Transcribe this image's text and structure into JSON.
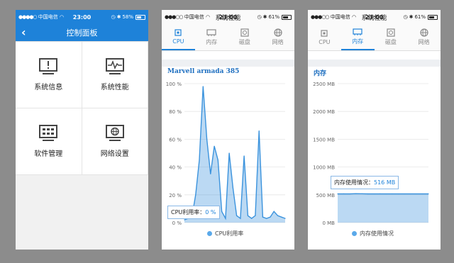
{
  "screen1": {
    "status": {
      "carrier": "中国电信",
      "time": "23:00",
      "battery": "58%"
    },
    "nav_title": "控制面板",
    "tiles": [
      {
        "label": "系统信息",
        "icon": "system-info-icon"
      },
      {
        "label": "系统性能",
        "icon": "system-performance-icon"
      },
      {
        "label": "软件管理",
        "icon": "software-manager-icon"
      },
      {
        "label": "网络设置",
        "icon": "network-settings-icon"
      }
    ]
  },
  "screen2": {
    "status": {
      "carrier": "中国电信",
      "time": "23:00",
      "battery": "61%"
    },
    "page_title": "系统性能",
    "tabs": [
      {
        "label": "CPU",
        "active": true
      },
      {
        "label": "内存",
        "active": false
      },
      {
        "label": "磁盘",
        "active": false
      },
      {
        "label": "网络",
        "active": false
      }
    ],
    "chart_title": "Marvell armada 385",
    "tooltip_label": "CPU利用率：",
    "tooltip_value": "0 %",
    "legend": "CPU利用率"
  },
  "screen3": {
    "status": {
      "carrier": "中国电信",
      "time": "23:00",
      "battery": "61%"
    },
    "page_title": "系统性能",
    "tabs": [
      {
        "label": "CPU",
        "active": false
      },
      {
        "label": "内存",
        "active": true
      },
      {
        "label": "磁盘",
        "active": false
      },
      {
        "label": "网络",
        "active": false
      }
    ],
    "chart_title": "内存",
    "tooltip_label": "内存使用情况：",
    "tooltip_value": "516 MB",
    "legend": "内存使用情况"
  },
  "chart_data": [
    {
      "type": "area",
      "title": "Marvell armada 385",
      "ylabel": "",
      "y_ticks": [
        "0 %",
        "20 %",
        "40 %",
        "60 %",
        "80 %",
        "100 %"
      ],
      "ylim": [
        0,
        100
      ],
      "series": [
        {
          "name": "CPU利用率",
          "values": [
            2,
            3,
            4,
            20,
            45,
            98,
            60,
            35,
            55,
            45,
            8,
            3,
            50,
            25,
            5,
            3,
            48,
            5,
            3,
            5,
            66,
            4,
            3,
            4,
            8,
            5,
            4,
            3
          ]
        }
      ],
      "color": "#3b93dd"
    },
    {
      "type": "area",
      "title": "内存",
      "ylabel": "",
      "y_ticks": [
        "0 MB",
        "500 MB",
        "1000 MB",
        "1500 MB",
        "2000 MB",
        "2500 MB"
      ],
      "ylim": [
        0,
        2500
      ],
      "series": [
        {
          "name": "内存使用情况",
          "values": [
            516,
            518,
            516,
            520,
            519,
            517,
            516,
            518,
            516,
            517,
            516,
            516,
            516,
            516,
            516,
            516
          ]
        }
      ],
      "color": "#3b93dd"
    }
  ]
}
